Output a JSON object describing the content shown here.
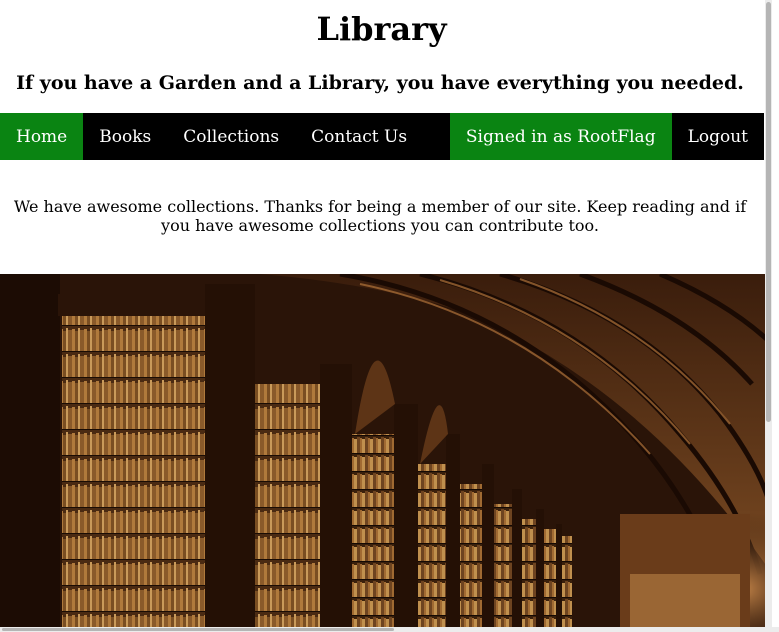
{
  "header": {
    "title": "Library",
    "tagline": "If you have a Garden and a Library, you have everything you needed."
  },
  "nav": {
    "items": [
      {
        "label": "Home",
        "active": true
      },
      {
        "label": "Books"
      },
      {
        "label": "Collections"
      },
      {
        "label": "Contact Us"
      }
    ],
    "signed_in": "Signed in as RootFlag",
    "logout": "Logout"
  },
  "main": {
    "intro": "We have awesome collections. Thanks for being a member of our site. Keep reading and if you have awesome collections you can contribute too."
  },
  "colors": {
    "nav_background": "#000000",
    "active_green": "#0a8412"
  }
}
